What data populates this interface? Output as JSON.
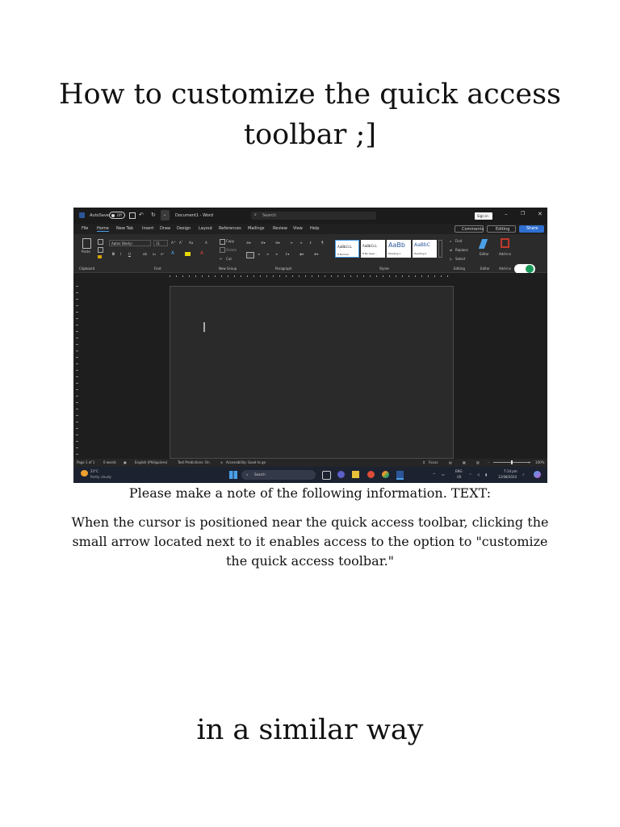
{
  "document": {
    "title": "How to customize the quick access toolbar ;]",
    "caption": "Please make a note of the following information. TEXT:",
    "body": "When the cursor is positioned near the quick access toolbar, clicking the small arrow located next to it enables access to the option to \"customize the quick access toolbar.\"",
    "footer": "in a similar way"
  },
  "screenshot": {
    "titlebar": {
      "autosave_label": "AutoSave",
      "autosave_state": "Off",
      "doc_name": "Document1 - Word",
      "search_placeholder": "Search",
      "signin": "Sign in"
    },
    "menu": [
      "File",
      "Home",
      "New Tab",
      "Insert",
      "Draw",
      "Design",
      "Layout",
      "References",
      "Mailings",
      "Review",
      "View",
      "Help"
    ],
    "menu_right": {
      "comments": "Comments",
      "editing": "Editing",
      "share": "Share"
    },
    "ribbon": {
      "paste": "Paste",
      "font_name": "Aptos (Body)",
      "font_size": "11",
      "copy": "Copy",
      "delete": "Delete",
      "cut": "Cut",
      "styles": [
        {
          "preview": "AaBbCcL",
          "label": "¶ Normal"
        },
        {
          "preview": "AaBbCcL",
          "label": "¶ No Spac..."
        },
        {
          "preview": "AaBb",
          "label": "Heading 1"
        },
        {
          "preview": "AaBbC",
          "label": "Heading 2"
        }
      ],
      "find": "Find",
      "replace": "Replace",
      "select": "Select",
      "editor": "Editor",
      "addins": "Add-ins",
      "groups": [
        "Clipboard",
        "Font",
        "New Group",
        "Paragraph",
        "Styles",
        "Editing",
        "Editor",
        "Add-ins"
      ]
    },
    "status": {
      "page": "Page 1 of 1",
      "words": "0 words",
      "language": "English (Philippines)",
      "predictions": "Text Predictions: On",
      "accessibility": "Accessibility: Good to go",
      "focus": "Focus",
      "zoom": "100%"
    },
    "taskbar": {
      "weather_temp": "23°C",
      "weather_desc": "Partly cloudy",
      "search": "Search",
      "lang": "ENG",
      "lang_sub": "US",
      "time": "7:14 pm",
      "date": "12/08/2024"
    },
    "colors": {
      "word_blue": "#2b579a",
      "accent_blue": "#4aa0e8",
      "share_blue": "#2f6fd0",
      "addins_red": "#c0392b",
      "green_badge": "#1a9a5a"
    }
  }
}
